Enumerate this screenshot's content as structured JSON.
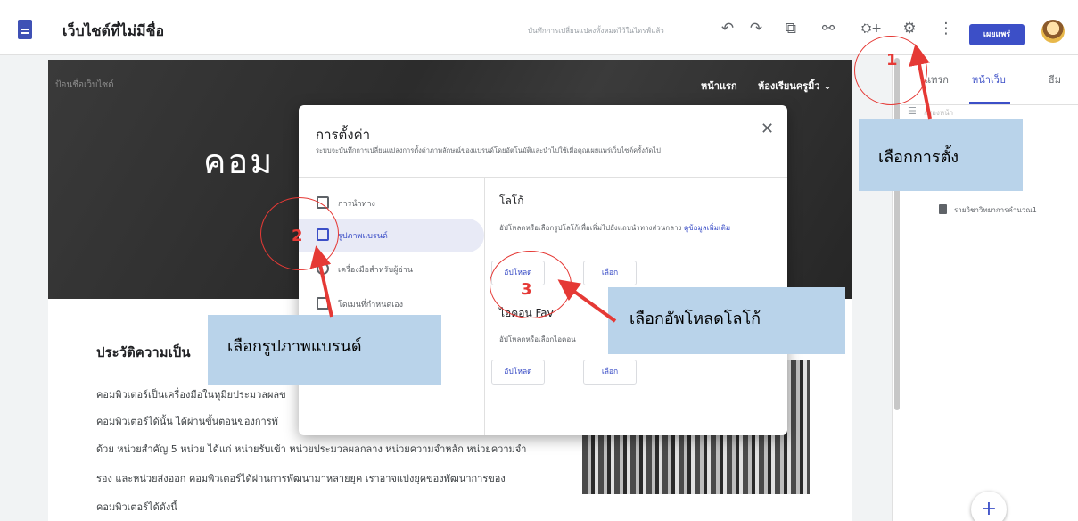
{
  "topbar": {
    "site_title": "เว็บไซต์ที่ไม่มีชื่อ",
    "save_status": "บันทึกการเปลี่ยนแปลงทั้งหมดไว้ในไดรฟ์แล้ว",
    "undo_icon": "↶",
    "redo_icon": "↷",
    "preview_icon": "⧉",
    "link_icon": "⚯",
    "share_icon": "⛭+",
    "settings_icon": "⚙",
    "more_icon": "⋮",
    "publish_label": "เผยแพร่"
  },
  "hero": {
    "site_name": "ป้อนชื่อเว็บไซต์",
    "nav_home": "หน้าแรก",
    "nav_class": "ห้องเรียนครูมิ้ว ⌄",
    "title": "คอม"
  },
  "content": {
    "heading": "ประวัติความเป็น",
    "lines": [
      "คอมพิวเตอร์เป็นเครื่องมือในหุมิยประมวลผลข",
      "คอมพิวเตอร์ได้นั้น ได้ผ่านขั้นตอนของการพั",
      "ด้วย หน่วยสำคัญ 5 หน่วย ได้แก่ หน่วยรับเข้า หน่วยประมวลผลกลาง หน่วยความจำหลัก หน่วยความจำ",
      "รอง และหน่วยส่งออก คอมพิวเตอร์ได้ผ่านการพัฒนามาหลายยุค เราอาจแบ่งยุคของพัฒนาการของ",
      "คอมพิวเตอร์ได้ดังนี้"
    ]
  },
  "right_panel": {
    "tabs": [
      "แทรก",
      "หน้าเว็บ",
      "ธีม"
    ],
    "filter_text": "กรองหน้า",
    "page_item": "รายวิชาวิทยาการคำนวณ1",
    "fab_label": "+"
  },
  "dialog": {
    "title": "การตั้งค่า",
    "description": "ระบบจะบันทึกการเปลี่ยนแปลงการตั้งค่าภาพลักษณ์ของแบรนด์โดยอัตโนมัติและนำไปใช้เมื่อคุณเผยแพร่เว็บไซต์ครั้งถัดไป",
    "close": "✕",
    "nav": [
      {
        "label": "การนำทาง"
      },
      {
        "label": "รูปภาพแบรนด์"
      },
      {
        "label": "เครื่องมือสำหรับผู้อ่าน"
      },
      {
        "label": "โดเมนที่กำหนดเอง"
      }
    ],
    "logo_title": "โลโก้",
    "logo_desc": "อัปโหลดหรือเลือกรูปโลโก้เพื่อเพิ่มไปยังแถบนำทางส่วนกลาง",
    "logo_link": "ดูข้อมูลเพิ่มเติม",
    "upload": "อัปโหลด",
    "select": "เลือก",
    "favicon_title": "ไอคอน Fav",
    "favicon_desc": "อัปโหลดหรือเลือกไอคอน"
  },
  "annotations": {
    "callout1": "เลือกการตั้ง",
    "callout2": "เลือกรูปภาพแบรนด์",
    "callout3": "เลือกอัพโหลดโลโก้",
    "step1": "1",
    "step2": "2",
    "step3": "3",
    "color": "#e53935"
  }
}
